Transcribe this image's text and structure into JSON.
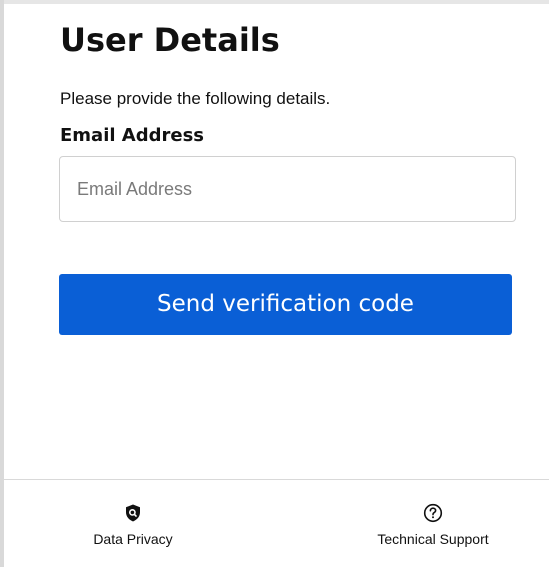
{
  "form": {
    "title": "User Details",
    "subtitle": "Please provide the following details.",
    "email_label": "Email Address",
    "email_value": "",
    "email_placeholder": "Email Address",
    "submit_label": "Send verification code"
  },
  "footer": {
    "links": [
      {
        "label": "Data Privacy",
        "icon": "shield-icon"
      },
      {
        "label": "Technical Support",
        "icon": "help-circle-icon"
      }
    ]
  },
  "colors": {
    "primary_button": "#0a5fd6",
    "button_text": "#ffffff",
    "text": "#111111",
    "placeholder": "#7a7a7a",
    "border": "#d0d0d0"
  }
}
